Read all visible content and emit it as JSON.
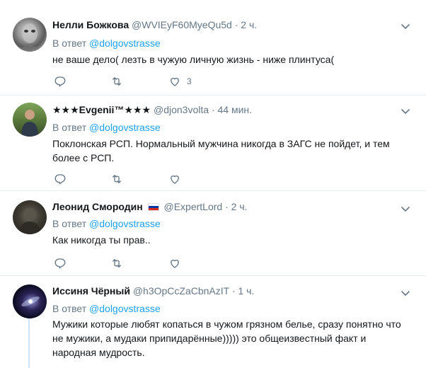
{
  "tweets": [
    {
      "name": "Нелли Божкова",
      "handle": "@WVIEyF60MyeQu5d",
      "dot": "·",
      "time": "2 ч.",
      "reply_prefix": "В ответ",
      "reply_to": "@dolgovstrasse",
      "text": "не ваше дело( лезть в чужую личную жизнь - ниже плинтуса(",
      "like_count": "3"
    },
    {
      "name": "★★★Evgenii™★★★",
      "handle": "@djon3volta",
      "dot": "·",
      "time": "44 мин.",
      "reply_prefix": "В ответ",
      "reply_to": "@dolgovstrasse",
      "text_lines": [
        "Поклонская РСП. Нормальный мужчина никогда в ЗАГС не пойдет, и тем",
        "более с РСП."
      ]
    },
    {
      "name": "Леонид Смородин",
      "handle": "@ExpertLord",
      "dot": "·",
      "time": "2 ч.",
      "reply_prefix": "В ответ",
      "reply_to": "@dolgovstrasse",
      "text": "Как никогда ты прав..",
      "flag_colors": [
        "#ffffff",
        "#0039a6",
        "#d52b1e"
      ]
    },
    {
      "name": "Иссиня Чёрный",
      "handle": "@h3OpCcZaCbnAzIT",
      "dot": "·",
      "time": "1 ч.",
      "reply_prefix": "В ответ",
      "reply_to": "@dolgovstrasse",
      "text_lines": [
        "Мужики которые любят копаться в чужом грязном белье, сразу понятно что",
        "не мужики, а мудаки припидарённые))))) это общеизвестный факт и",
        "народная мудрость."
      ]
    }
  ],
  "icons": {
    "reply": "reply-icon",
    "retweet": "retweet-icon",
    "like": "heart-icon",
    "more": "chevron-down-icon"
  },
  "colors": {
    "link": "#1da1f2",
    "muted": "#657786",
    "text": "#14171a",
    "divider": "#e6ecf0",
    "thread": "#cce4f7"
  }
}
